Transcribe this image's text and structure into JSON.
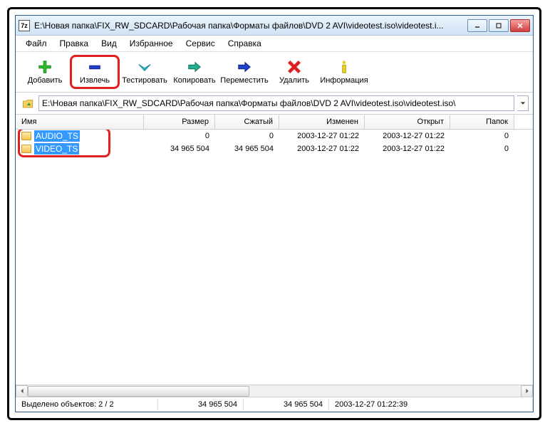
{
  "titlebar": {
    "icon_text": "7z",
    "title": "E:\\Новая папка\\FIX_RW_SDCARD\\Рабочая папка\\Форматы файлов\\DVD 2 AVI\\videotest.iso\\videotest.i..."
  },
  "menu": {
    "file": "Файл",
    "edit": "Правка",
    "view": "Вид",
    "favorites": "Избранное",
    "tools": "Сервис",
    "help": "Справка"
  },
  "toolbar": {
    "add": "Добавить",
    "extract": "Извлечь",
    "test": "Тестировать",
    "copy": "Копировать",
    "move": "Переместить",
    "delete": "Удалить",
    "info": "Информация"
  },
  "path": "E:\\Новая папка\\FIX_RW_SDCARD\\Рабочая папка\\Форматы файлов\\DVD 2 AVI\\videotest.iso\\videotest.iso\\",
  "columns": {
    "name": "Имя",
    "size": "Размер",
    "packed": "Сжатый",
    "modified": "Изменен",
    "opened": "Открыт",
    "folders": "Папок"
  },
  "rows": [
    {
      "name": "AUDIO_TS",
      "size": "0",
      "packed": "0",
      "modified": "2003-12-27 01:22",
      "opened": "2003-12-27 01:22",
      "folders": "0"
    },
    {
      "name": "VIDEO_TS",
      "size": "34 965 504",
      "packed": "34 965 504",
      "modified": "2003-12-27 01:22",
      "opened": "2003-12-27 01:22",
      "folders": "0"
    }
  ],
  "status": {
    "selected": "Выделено объектов: 2 / 2",
    "size": "34 965 504",
    "size2": "34 965 504",
    "date": "2003-12-27 01:22:39"
  }
}
